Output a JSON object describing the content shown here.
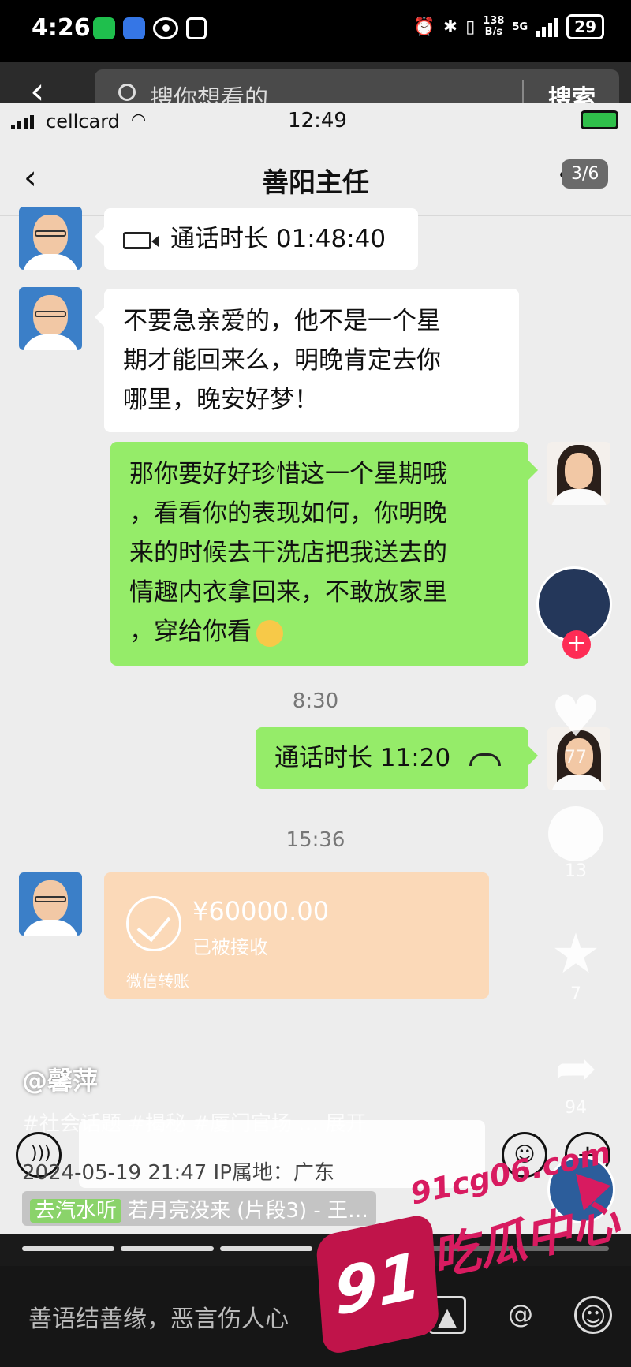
{
  "outer_status": {
    "time": "4:26",
    "speed_top": "138",
    "speed_bottom": "B/s",
    "network": "5G",
    "battery": "29"
  },
  "search": {
    "placeholder": "搜你想看的",
    "button": "搜索"
  },
  "inner_status": {
    "carrier": "cellcard",
    "time": "12:49"
  },
  "chat": {
    "title": "善阳主任",
    "more": "•••",
    "page_indicator": "3/6",
    "msg1_call": "通话时长 01:48:40",
    "msg2_lines": [
      "不要急亲爱的，他不是一个星",
      "期才能回来么，明晚肯定去你",
      "哪里，晚安好梦！"
    ],
    "msg3_lines": [
      "那你要好好珍惜这一个星期哦",
      "，看看你的表现如何，你明晚",
      "来的时候去干洗店把我送去的",
      "情趣内衣拿回来，不敢放家里",
      "，穿给你看"
    ],
    "time1": "8:30",
    "msg4_call": "通话时长 11:20",
    "time2": "15:36",
    "transfer_amount": "¥60000.00",
    "transfer_status": "已被接收",
    "transfer_footer": "微信转账"
  },
  "video": {
    "like_count": "77",
    "comment_count": "13",
    "fav_count": "7",
    "share_count": "94",
    "author": "@馨萍",
    "tags": "#社会话题 #揭秘 #厦门官场 … 展开",
    "meta": "2024-05-19 21:47  IP属地：广东",
    "music_pill": "去汽水听",
    "music": "若月亮没来 (片段3) - 王…"
  },
  "comment_bar": {
    "hint": "善语结善缘，恶言伤人心"
  },
  "watermark": {
    "badge": "91",
    "url": "91cg06.com",
    "cn": "吃瓜中心"
  },
  "colors": {
    "wechat_green": "#95ec69",
    "transfer_orange": "#fbd9b8",
    "watermark_pink": "#d81b60"
  }
}
